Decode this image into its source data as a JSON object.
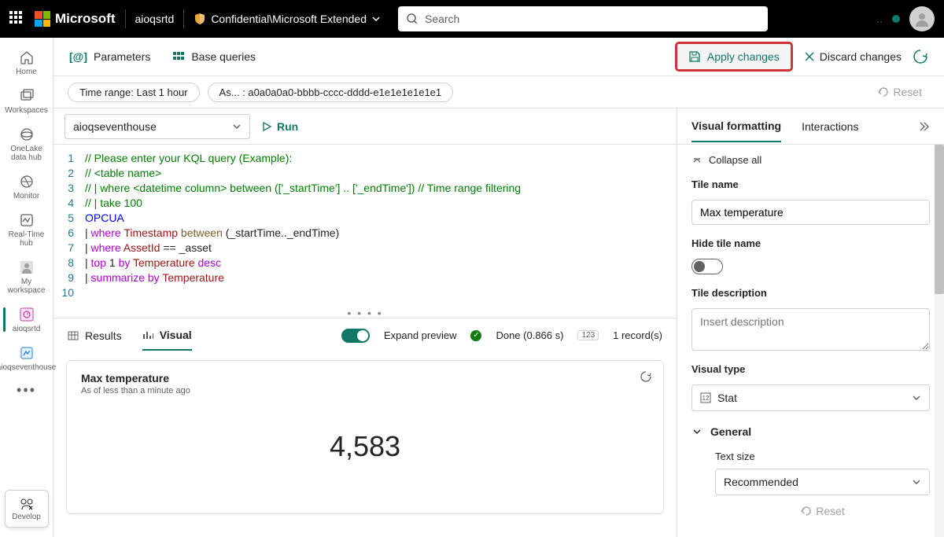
{
  "topbar": {
    "brand": "Microsoft",
    "workspace": "aioqsrtd",
    "sensitivity": "Confidential\\Microsoft Extended",
    "search_placeholder": "Search"
  },
  "leftnav": {
    "items": [
      {
        "label": "Home"
      },
      {
        "label": "Workspaces"
      },
      {
        "label": "OneLake data hub"
      },
      {
        "label": "Monitor"
      },
      {
        "label": "Real-Time hub"
      },
      {
        "label": "My workspace"
      },
      {
        "label": "aioqsrtd"
      },
      {
        "label": "aioqseventhouse"
      }
    ],
    "develop": "Develop"
  },
  "tabbar": {
    "parameters": "Parameters",
    "base_queries": "Base queries",
    "apply": "Apply changes",
    "discard": "Discard changes"
  },
  "pills": {
    "time_range": "Time range: Last 1 hour",
    "asset": "As... : a0a0a0a0-bbbb-cccc-dddd-e1e1e1e1e1e1",
    "reset": "Reset"
  },
  "runbar": {
    "database": "aioqseventhouse",
    "run": "Run"
  },
  "code": {
    "l1": "// Please enter your KQL query (Example):",
    "l2": "// <table name>",
    "l3": "// | where <datetime column> between (['_startTime'] .. ['_endTime']) // Time range filtering",
    "l4": "// | take 100",
    "l5": "OPCUA",
    "l6_pipe": "| ",
    "l6_kw": "where ",
    "l6_col": "Timestamp ",
    "l6_fn": "between ",
    "l6_args": "(_startTime.._endTime)",
    "l7_pipe": "| ",
    "l7_kw": "where ",
    "l7_col": "AssetId ",
    "l7_eq": "== ",
    "l7_val": "_asset",
    "l8_pipe": "| ",
    "l8_kw": "top ",
    "l8_n": "1 ",
    "l8_by": "by ",
    "l8_col": "Temperature ",
    "l8_dir": "desc",
    "l9_pipe": "| ",
    "l9_kw": "summarize ",
    "l9_by": "by ",
    "l9_col": "Temperature"
  },
  "results": {
    "tab_results": "Results",
    "tab_visual": "Visual",
    "expand": "Expand preview",
    "done": "Done (0.866 s)",
    "records": "1 record(s)"
  },
  "card": {
    "title": "Max temperature",
    "asof": "As of less than a minute ago",
    "value": "4,583"
  },
  "side": {
    "tab_visual": "Visual formatting",
    "tab_interactions": "Interactions",
    "collapse": "Collapse all",
    "tile_name_label": "Tile name",
    "tile_name_value": "Max temperature",
    "hide_tile": "Hide tile name",
    "tile_desc_label": "Tile description",
    "tile_desc_placeholder": "Insert description",
    "visual_type_label": "Visual type",
    "visual_type_value": "Stat",
    "general": "General",
    "text_size": "Text size",
    "text_size_value": "Recommended",
    "reset": "Reset"
  },
  "chart_data": {
    "type": "stat",
    "title": "Max temperature",
    "value": 4583,
    "formatted": "4,583",
    "asof": "As of less than a minute ago",
    "record_count": 1,
    "query_duration_s": 0.866
  }
}
